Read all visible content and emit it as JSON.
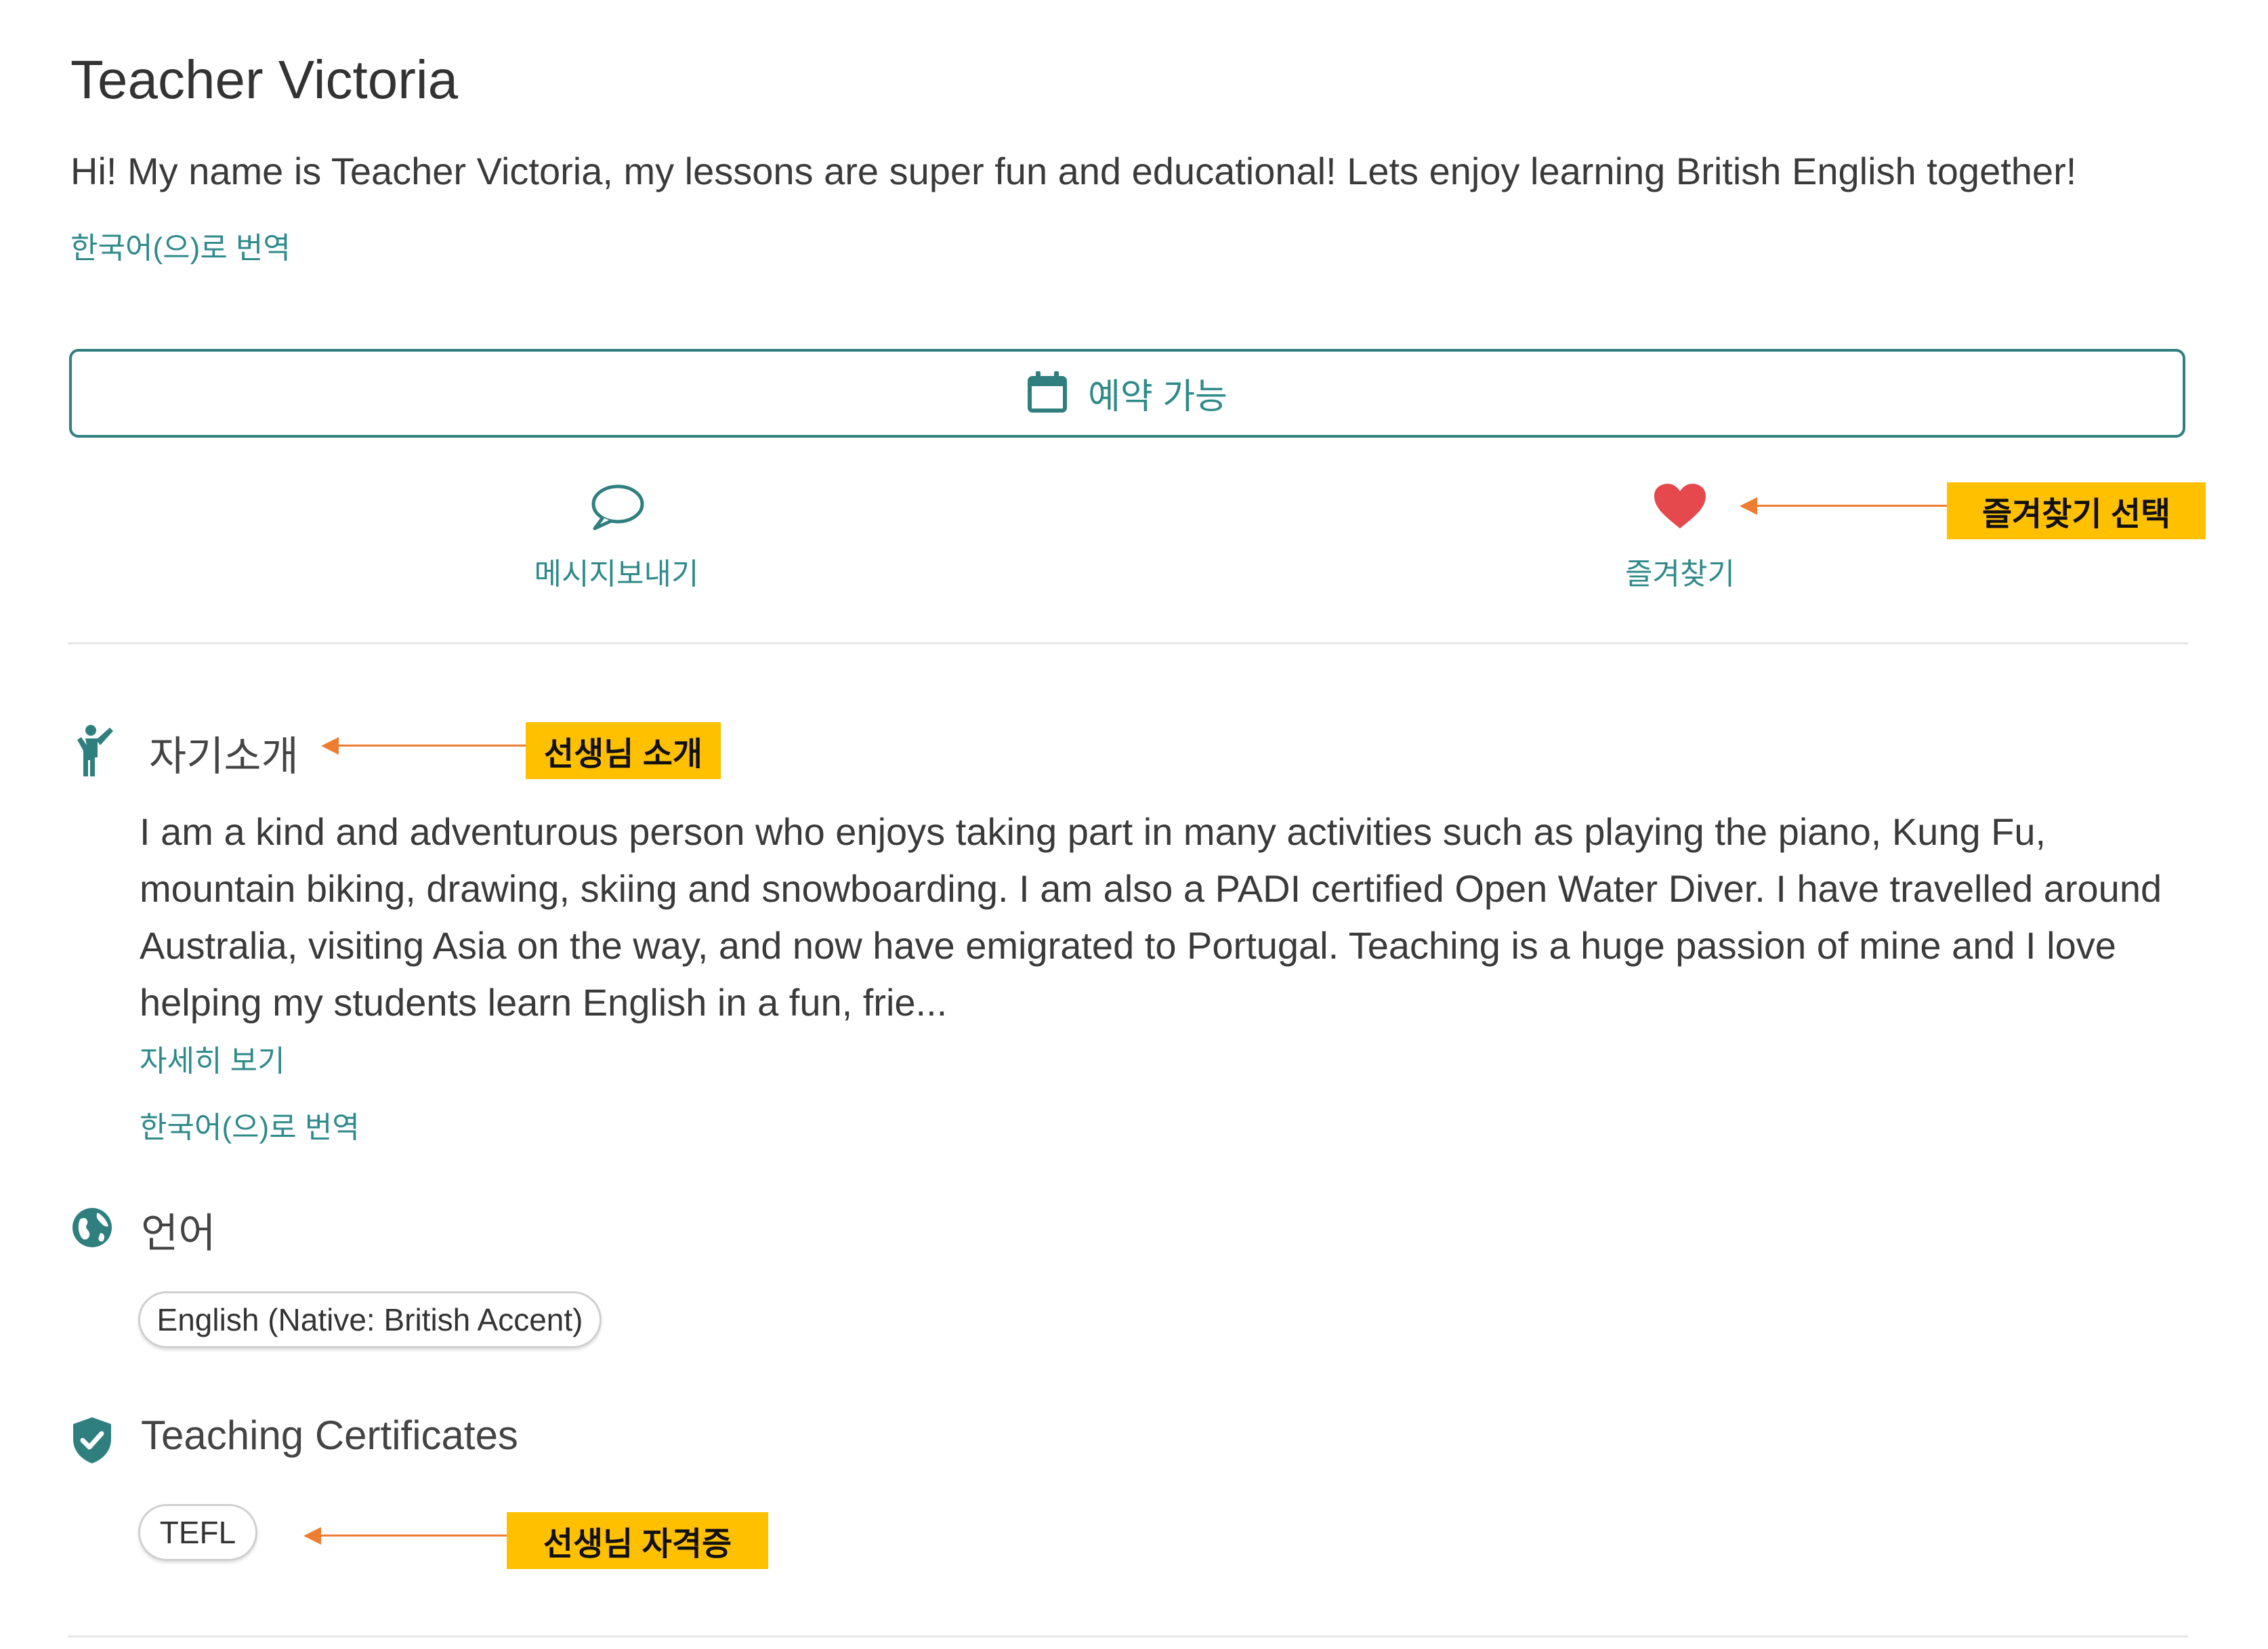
{
  "profile": {
    "name": "Teacher Victoria",
    "headline": "Hi! My name is Teacher Victoria, my lessons are super fun and educational! Lets enjoy learning British English together!",
    "translate_label": "한국어(으)로 번역"
  },
  "booking": {
    "label": "예약 가능",
    "icon": "calendar-icon"
  },
  "actions": {
    "message": {
      "label": "메시지보내기",
      "icon": "speech-bubble-icon"
    },
    "favorite": {
      "label": "즐겨찾기",
      "icon": "heart-icon"
    }
  },
  "about": {
    "title": "자기소개",
    "icon": "person-waving-icon",
    "text": "I am a kind and adventurous person who enjoys taking part in many activities such as playing the piano, Kung Fu, mountain biking, drawing, skiing and snowboarding. I am also a PADI certified Open Water Diver. I have travelled around Australia, visiting Asia on the way, and now have emigrated to Portugal. Teaching is a huge passion of mine and I love helping my students learn English in a fun, frie...",
    "more_label": "자세히 보기",
    "translate_label": "한국어(으)로 번역"
  },
  "languages": {
    "title": "언어",
    "icon": "globe-icon",
    "items": [
      "English (Native: British Accent)"
    ]
  },
  "certificates": {
    "title": "Teaching Certificates",
    "icon": "shield-check-icon",
    "items": [
      "TEFL"
    ]
  },
  "annotations": {
    "favorite": "즐겨찾기 선택",
    "intro": "선생님 소개",
    "certificate": "선생님 자격증"
  },
  "colors": {
    "accent": "#2f8a8a",
    "heart": "#e5484d",
    "callout": "#ffc000",
    "arrow": "#ed7d31"
  }
}
